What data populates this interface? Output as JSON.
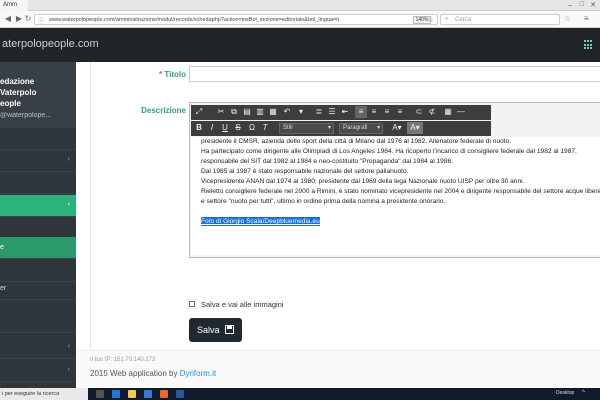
{
  "browser": {
    "tab_title": "Amm",
    "url": "www.waterpolopeople.com/amministrazione/modul/records/schedaphp?action=insBol_sezione=editoriale&bol_lingua=it",
    "zoom": "140%",
    "search_placeholder": "Cerca"
  },
  "header": {
    "brand": "aterpolopeople.com"
  },
  "sidebar": {
    "profile_name": "edazione\nVaterpolo\neople",
    "profile_email": "@waterpolope...",
    "items": [
      {
        "label": ""
      },
      {
        "label": ""
      },
      {
        "label": ""
      },
      {
        "label": "e"
      },
      {
        "label": ""
      },
      {
        "label": "er"
      },
      {
        "label": ""
      },
      {
        "label": ""
      }
    ]
  },
  "form": {
    "titolo_label": "Titolo",
    "titolo_required": "*",
    "titolo_value": "",
    "descrizione_label": "Descrizione",
    "toolbar": {
      "font_select": "Stili",
      "format_select": "Paragrafi"
    },
    "content_lines": [
      "presidente il CMSR, azienda dello sport della città di Milano dal 1976 al 1982. Allenatore federale di nuoto.",
      "Ha partecipato come dirigente alle Olimpiadi di Los Angeles 1984. Ha ricoperto l'incarico di consigliere federale dal 1982 al 1987,",
      "responsabile del SIT dal 1982 al 1984 e neo-costituito \"Propaganda\" dal 1984 al 1986.",
      "Dal 1985 al 1987 è stato responsabile nazionale del settore pallanuoto.",
      "Vicepresidente ANAN dal 1974 al 1980; presidente dal 1969 della lega Nazionale nuoto UISP per oltre 30 anni.",
      "Rieletto consigliere federale nel 2000 a Rimini, è stato nominato vicepresidente nel 2004 e dirigente responsabile del settore acque libere",
      "e settore \"nuoto per tutti\", ultimo in ordine prima della nomina a presidente onorario."
    ],
    "photo_credit": "Foto di Giorgio Scala/Deepbluemedia.eu",
    "checkbox_label": "Salva e vai alle immagini",
    "save_label": "Salva"
  },
  "footer": {
    "ip_label": "Il tuo IP",
    "ip_value": "151.70.140.173",
    "copyright_prefix": "2015 Web application by",
    "copyright_link": "Dynform.it"
  },
  "taskbar": {
    "search_text": "i per eseguire la ricerca",
    "desktop_label": "Desktop"
  },
  "colors": {
    "accent_green": "#2bb37b",
    "dark_header": "#1f2428",
    "sidebar": "#2f363b",
    "selection_blue": "#1a6fd6"
  }
}
